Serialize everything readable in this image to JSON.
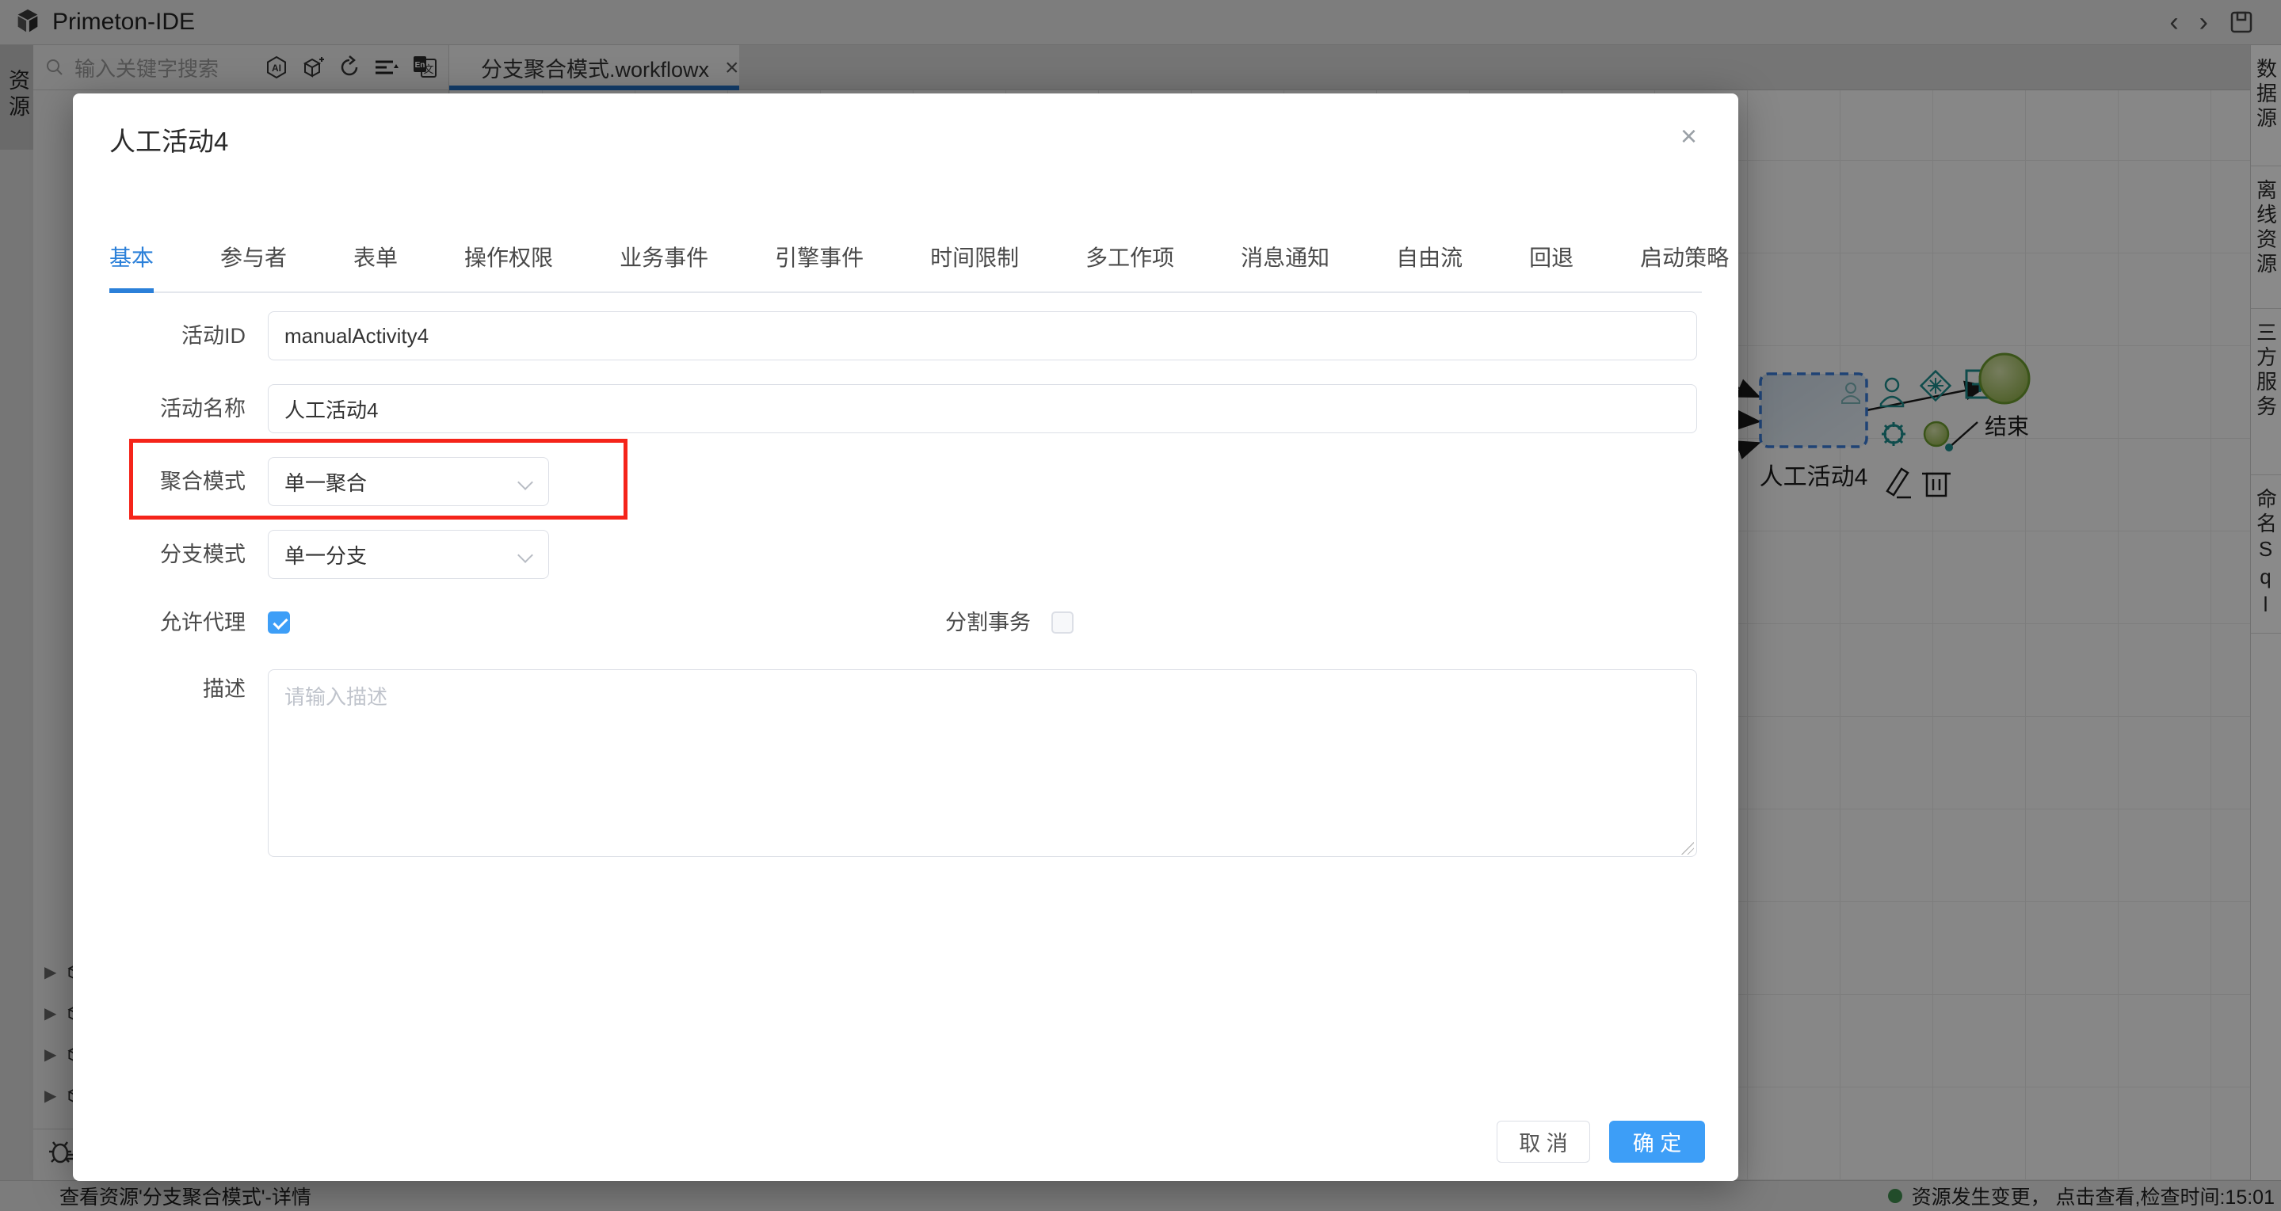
{
  "app": {
    "title": "Primeton-IDE"
  },
  "left_rail": {
    "active_tab": "资源"
  },
  "explorer": {
    "search_placeholder": "输入关键字搜索"
  },
  "editor_tab": {
    "label": "分支聚合模式.workflowx"
  },
  "right_rail": {
    "items": [
      "数据源",
      "离线资源",
      "三方服务",
      "命名Sql"
    ]
  },
  "canvas": {
    "selected_node_label": "人工活动4",
    "end_node_label": "结束"
  },
  "dialog": {
    "title": "人工活动4",
    "tabs": [
      {
        "label": "基本",
        "active": true
      },
      {
        "label": "参与者",
        "active": false
      },
      {
        "label": "表单",
        "active": false
      },
      {
        "label": "操作权限",
        "active": false
      },
      {
        "label": "业务事件",
        "active": false
      },
      {
        "label": "引擎事件",
        "active": false
      },
      {
        "label": "时间限制",
        "active": false
      },
      {
        "label": "多工作项",
        "active": false
      },
      {
        "label": "消息通知",
        "active": false
      },
      {
        "label": "自由流",
        "active": false
      },
      {
        "label": "回退",
        "active": false
      },
      {
        "label": "启动策略",
        "active": false
      }
    ],
    "fields": {
      "activity_id": {
        "label": "活动ID",
        "value": "manualActivity4"
      },
      "activity_name": {
        "label": "活动名称",
        "value": "人工活动4"
      },
      "aggregation_mode": {
        "label": "聚合模式",
        "value": "单一聚合",
        "highlighted": true
      },
      "branch_mode": {
        "label": "分支模式",
        "value": "单一分支"
      },
      "allow_delegate": {
        "label": "允许代理",
        "checked": true
      },
      "split_transaction": {
        "label": "分割事务",
        "checked": false
      },
      "description": {
        "label": "描述",
        "value": "",
        "placeholder": "请输入描述"
      }
    },
    "buttons": {
      "cancel": "取 消",
      "ok": "确 定"
    }
  },
  "status_bar": {
    "left": "查看资源'分支聚合模式'-详情",
    "right": "资源发生变更， 点击查看,检查时间:15:01"
  },
  "colors": {
    "accent_blue": "#3d9ef7",
    "tab_active_blue": "#2b80d9",
    "highlight_red": "#f5241a",
    "status_green": "#3f8a4d",
    "editor_tab_underline": "#2470c2",
    "workflow_icon_orange": "#c08a2f",
    "node_teal": "#1c8a8a"
  }
}
